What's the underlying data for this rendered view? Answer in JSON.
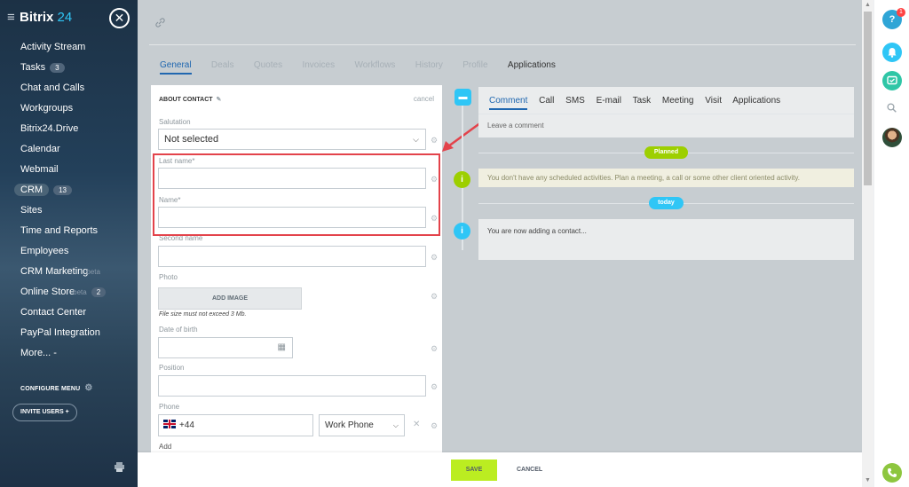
{
  "sidebar": {
    "brand_name": "Bitrix",
    "brand_accent": "24",
    "close_symbol": "✕",
    "items": [
      {
        "label": "Activity Stream"
      },
      {
        "label": "Tasks",
        "count": "3"
      },
      {
        "label": "Chat and Calls"
      },
      {
        "label": "Workgroups"
      },
      {
        "label": "Bitrix24.Drive"
      },
      {
        "label": "Calendar"
      },
      {
        "label": "Webmail"
      },
      {
        "label": "CRM",
        "count": "13"
      },
      {
        "label": "Sites"
      },
      {
        "label": "Time and Reports"
      },
      {
        "label": "Employees"
      },
      {
        "label": "CRM Marketing",
        "suffix": "beta"
      },
      {
        "label": "Online Store",
        "suffix": "beta",
        "count": "2"
      },
      {
        "label": "Contact Center"
      },
      {
        "label": "PayPal Integration"
      },
      {
        "label": "More... -"
      }
    ],
    "configure_menu": "CONFIGURE MENU",
    "invite_users": "INVITE USERS"
  },
  "main": {
    "tabs": [
      {
        "label": "General"
      },
      {
        "label": "Deals"
      },
      {
        "label": "Quotes"
      },
      {
        "label": "Invoices"
      },
      {
        "label": "Workflows"
      },
      {
        "label": "History"
      },
      {
        "label": "Profile"
      },
      {
        "label": "Applications"
      }
    ]
  },
  "form": {
    "title": "ABOUT CONTACT",
    "cancel": "cancel",
    "salutation_label": "Salutation",
    "salutation_value": "Not selected",
    "last_name_label": "Last name*",
    "name_label": "Name*",
    "second_name_label": "Second name",
    "photo_label": "Photo",
    "add_image": "ADD IMAGE",
    "file_note": "File size must not exceed 3 Mb.",
    "dob_label": "Date of birth",
    "position_label": "Position",
    "phone_label": "Phone",
    "phone_value": "+44",
    "phone_type": "Work Phone",
    "add": "Add"
  },
  "timeline": {
    "tabs": [
      "Comment",
      "Call",
      "SMS",
      "E-mail",
      "Task",
      "Meeting",
      "Visit",
      "Applications"
    ],
    "comment_placeholder": "Leave a comment",
    "planned_label": "Planned",
    "planned_text": "You don't have any scheduled activities. Plan a meeting, a call or some other client oriented activity.",
    "today_label": "today",
    "today_text": "You are now adding a contact..."
  },
  "actions": {
    "save": "SAVE",
    "cancel": "CANCEL"
  },
  "rail": {
    "help": "?",
    "help_badge": "1"
  },
  "colors": {
    "accent_blue": "#2067b0",
    "planned_green": "#9dcf00",
    "today_blue": "#2fc6f6",
    "highlight_red": "#e3434b",
    "save_green": "#bbed21"
  }
}
